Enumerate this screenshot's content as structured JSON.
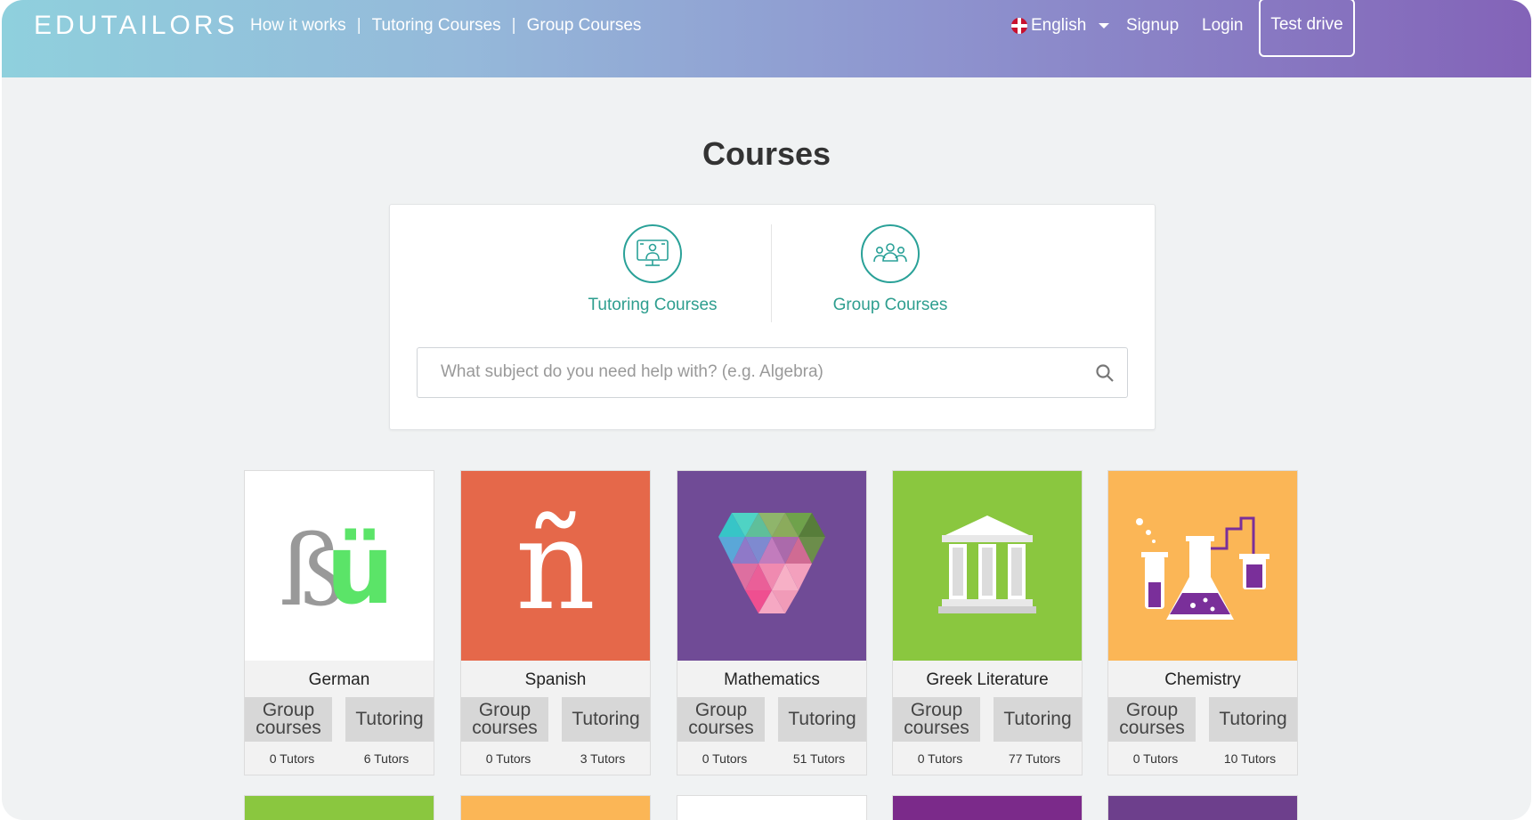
{
  "header": {
    "logo": "EDUTAILORS",
    "nav": [
      "How it works",
      "Tutoring Courses",
      "Group Courses"
    ],
    "language": "English",
    "signup": "Signup",
    "login": "Login",
    "test_drive": "Test drive"
  },
  "page_title": "Courses",
  "categories": [
    {
      "label": "Tutoring Courses",
      "icon": "monitor-tutor-icon"
    },
    {
      "label": "Group Courses",
      "icon": "group-people-icon"
    }
  ],
  "search": {
    "placeholder": "What subject do you need help with? (e.g. Algebra)",
    "value": ""
  },
  "course_button_labels": {
    "group": "Group courses",
    "tutoring": "Tutoring"
  },
  "courses": [
    {
      "name": "German",
      "image_letters": "ßü",
      "group_tutors": "0 Tutors",
      "tutoring_tutors": "6 Tutors",
      "bg": "#ffffff"
    },
    {
      "name": "Spanish",
      "image_letters": "ñ",
      "group_tutors": "0 Tutors",
      "tutoring_tutors": "3 Tutors",
      "bg": "#e5684a"
    },
    {
      "name": "Mathematics",
      "group_tutors": "0 Tutors",
      "tutoring_tutors": "51 Tutors",
      "bg": "#704b96"
    },
    {
      "name": "Greek Literature",
      "group_tutors": "0 Tutors",
      "tutoring_tutors": "77 Tutors",
      "bg": "#8ac73f"
    },
    {
      "name": "Chemistry",
      "group_tutors": "0 Tutors",
      "tutoring_tutors": "10 Tutors",
      "bg": "#fbb656"
    }
  ],
  "next_row_colors": [
    "#8ac73f",
    "#fbb656",
    "#ffffff",
    "#7b2a8a",
    "#6d3f8c"
  ],
  "colors": {
    "accent_teal": "#2aa198",
    "header_start": "#8fd0dd",
    "header_end": "#8363b8"
  }
}
